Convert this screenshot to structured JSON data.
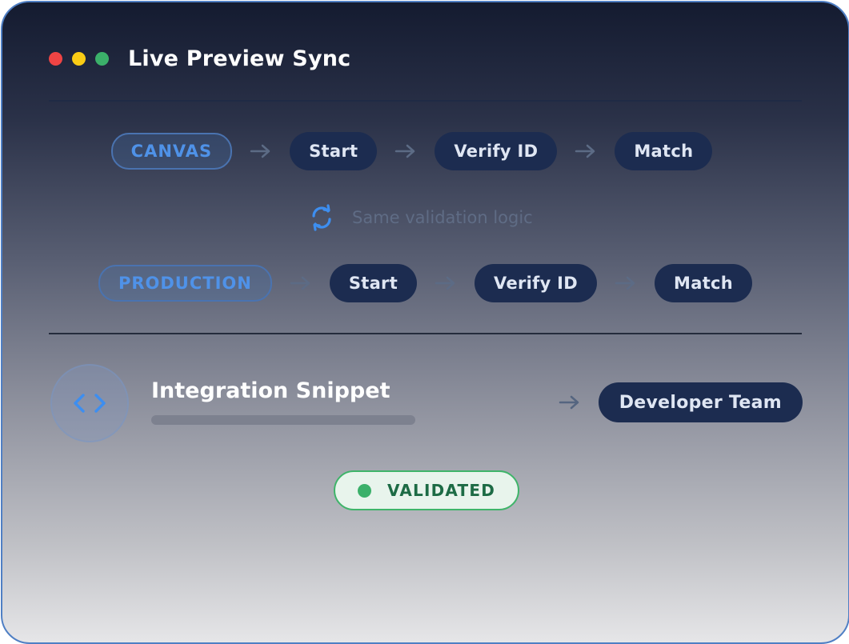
{
  "window": {
    "title": "Live Preview Sync",
    "controls": [
      {
        "name": "close",
        "color": "#ef4444"
      },
      {
        "name": "minimize",
        "color": "#facc15"
      },
      {
        "name": "maximize",
        "color": "#3bb06a"
      }
    ]
  },
  "flows": [
    {
      "environment": "CANVAS",
      "steps": [
        "Start",
        "Verify ID",
        "Match"
      ]
    },
    {
      "environment": "PRODUCTION",
      "steps": [
        "Start",
        "Verify ID",
        "Match"
      ]
    }
  ],
  "sync": {
    "label": "Same validation logic",
    "icon": "sync-icon"
  },
  "snippet": {
    "title": "Integration Snippet",
    "icon": "code-icon",
    "recipient": "Developer Team"
  },
  "status": {
    "label": "VALIDATED",
    "color": "#3bb06a"
  },
  "colors": {
    "accent": "#4f92e8",
    "pill": "#1c2c50",
    "success": "#3bb06a"
  }
}
